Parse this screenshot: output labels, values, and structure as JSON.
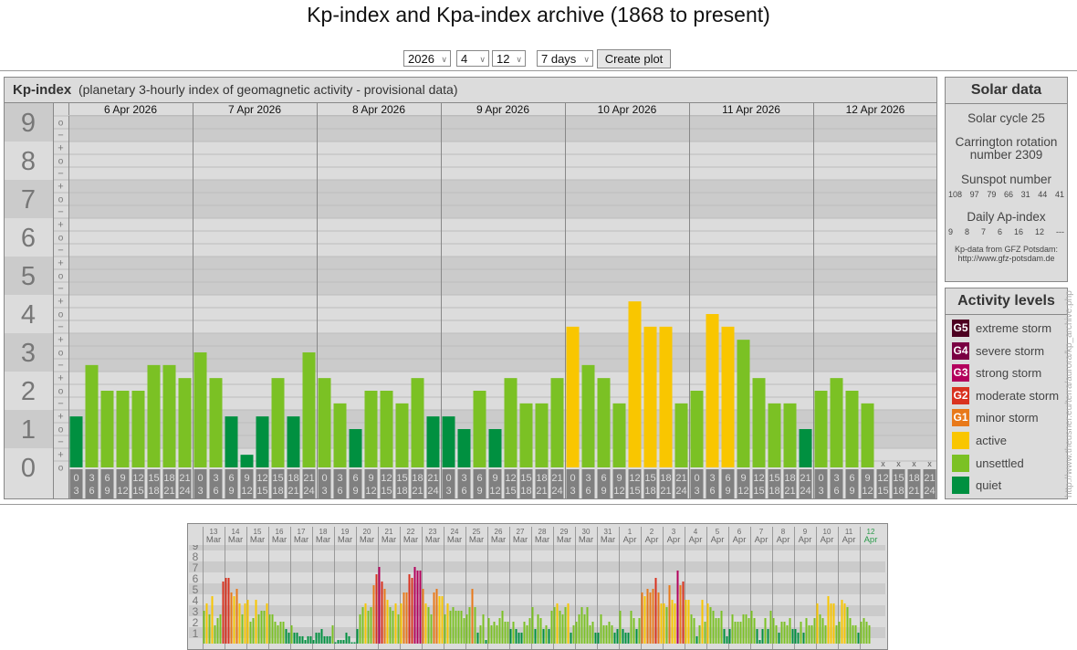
{
  "page": {
    "title": "Kp-index and Kpa-index archive (1868 to present)"
  },
  "controls": {
    "year": "2026",
    "month": "4",
    "day": "12",
    "range": "7 days",
    "create_label": "Create plot"
  },
  "kp_panel": {
    "title": "Kp-index",
    "subtitle": "(planetary 3-hourly index of geomagnetic activity - provisional data)"
  },
  "solar": {
    "title": "Solar data",
    "cycle": "Solar cycle 25",
    "carrington": "Carrington rotation number 2309",
    "sunspot_label": "Sunspot number",
    "sunspots": [
      "108",
      "97",
      "79",
      "66",
      "31",
      "44",
      "41"
    ],
    "ap_label": "Daily Ap-index",
    "ap": [
      "9",
      "8",
      "7",
      "6",
      "16",
      "12",
      "---"
    ],
    "source_line1": "Kp-data from GFZ Potsdam:",
    "source_line2": "http://www.gfz-potsdam.de"
  },
  "activity": {
    "title": "Activity levels",
    "items": [
      {
        "code": "G5",
        "label": "extreme storm",
        "color": "#4d0020"
      },
      {
        "code": "G4",
        "label": "severe storm",
        "color": "#7a0042"
      },
      {
        "code": "G3",
        "label": "strong storm",
        "color": "#b3005c"
      },
      {
        "code": "G2",
        "label": "moderate storm",
        "color": "#d9321f"
      },
      {
        "code": "G1",
        "label": "minor storm",
        "color": "#e8791a"
      },
      {
        "code": "",
        "label": "active",
        "color": "#f9c600"
      },
      {
        "code": "",
        "label": "unsettled",
        "color": "#7bc124"
      },
      {
        "code": "",
        "label": "quiet",
        "color": "#009040"
      }
    ]
  },
  "side_url": "http://www.theusner.eu/terra/aurora/kp_archive.php",
  "chart_data": [
    {
      "type": "bar",
      "title": "Kp-index",
      "ylabel": "Kp",
      "ylim": [
        0,
        9
      ],
      "y_ticks": [
        "0",
        "1",
        "2",
        "3",
        "4",
        "5",
        "6",
        "7",
        "8",
        "9"
      ],
      "y_subticks": [
        "o",
        "−",
        "+"
      ],
      "missing_marker": "x",
      "intervals": [
        [
          "0",
          "3"
        ],
        [
          "3",
          "6"
        ],
        [
          "6",
          "9"
        ],
        [
          "9",
          "12"
        ],
        [
          "12",
          "15"
        ],
        [
          "15",
          "18"
        ],
        [
          "18",
          "21"
        ],
        [
          "21",
          "24"
        ]
      ],
      "days": [
        {
          "label": "6 Apr 2026",
          "values": [
            1.33,
            2.67,
            2,
            2,
            2,
            2.67,
            2.67,
            2.33
          ]
        },
        {
          "label": "7 Apr 2026",
          "values": [
            3,
            2.33,
            1.33,
            0.33,
            1.33,
            2.33,
            1.33,
            3
          ]
        },
        {
          "label": "8 Apr 2026",
          "values": [
            2.33,
            1.67,
            1,
            2,
            2,
            1.67,
            2.33,
            1.33
          ]
        },
        {
          "label": "9 Apr 2026",
          "values": [
            1.33,
            1,
            2,
            1,
            2.33,
            1.67,
            1.67,
            2.33
          ]
        },
        {
          "label": "10 Apr 2026",
          "values": [
            3.67,
            2.67,
            2.33,
            1.67,
            4.33,
            3.67,
            3.67,
            1.67
          ]
        },
        {
          "label": "11 Apr 2026",
          "values": [
            2,
            4,
            3.67,
            3.33,
            2.33,
            1.67,
            1.67,
            1
          ]
        },
        {
          "label": "12 Apr 2026",
          "values": [
            2,
            2.33,
            2,
            1.67,
            null,
            null,
            null,
            null
          ]
        }
      ]
    },
    {
      "type": "bar",
      "title": "Kp-index last 31 days",
      "ylim": [
        0,
        9
      ],
      "y_ticks": [
        "1",
        "2",
        "3",
        "4",
        "5",
        "6",
        "7",
        "8",
        "9"
      ],
      "days": [
        {
          "d": "13",
          "m": "Mar",
          "values": [
            3,
            3.67,
            2.67,
            4.33,
            1.67,
            2.33,
            2.67,
            5.67
          ]
        },
        {
          "d": "14",
          "m": "Mar",
          "values": [
            6,
            6,
            4.67,
            4.33,
            5,
            3.67,
            2.67,
            3.67
          ]
        },
        {
          "d": "15",
          "m": "Mar",
          "values": [
            4,
            2,
            2.33,
            4,
            2.67,
            3,
            3,
            3.67
          ]
        },
        {
          "d": "16",
          "m": "Mar",
          "values": [
            2.67,
            2.67,
            2,
            1.67,
            2,
            2,
            1.33,
            1
          ]
        },
        {
          "d": "17",
          "m": "Mar",
          "values": [
            1.67,
            1,
            1,
            0.67,
            0.67,
            0.33,
            0.67,
            0.67
          ]
        },
        {
          "d": "18",
          "m": "Mar",
          "values": [
            0.33,
            1,
            1,
            1.33,
            0.67,
            0.67,
            0.67,
            1.67
          ]
        },
        {
          "d": "19",
          "m": "Mar",
          "values": [
            0,
            0.33,
            0.33,
            0.33,
            1,
            0.67,
            0,
            0
          ]
        },
        {
          "d": "20",
          "m": "Mar",
          "values": [
            1.33,
            2.67,
            3.33,
            3.67,
            3,
            3.33,
            5.33,
            6.33
          ]
        },
        {
          "d": "21",
          "m": "Mar",
          "values": [
            7,
            5.67,
            5,
            4,
            3.33,
            3,
            3.67,
            2.67
          ]
        },
        {
          "d": "22",
          "m": "Mar",
          "values": [
            3.67,
            4.67,
            4.67,
            6.33,
            6,
            7,
            6.67,
            6.67
          ]
        },
        {
          "d": "23",
          "m": "Mar",
          "values": [
            5,
            3.67,
            3.33,
            2.67,
            4.67,
            5,
            4.33,
            4.33
          ]
        },
        {
          "d": "24",
          "m": "Mar",
          "values": [
            2.67,
            3.67,
            3,
            3.33,
            3,
            3,
            3,
            2.33
          ]
        },
        {
          "d": "25",
          "m": "Mar",
          "values": [
            2.67,
            3.33,
            5,
            3.33,
            1,
            1.67,
            2.67,
            0.33
          ]
        },
        {
          "d": "26",
          "m": "Mar",
          "values": [
            2.33,
            1.67,
            2,
            1.67,
            2.33,
            3,
            2,
            2
          ]
        },
        {
          "d": "27",
          "m": "Mar",
          "values": [
            1.33,
            2,
            1.33,
            1,
            1,
            2,
            1.67,
            2.33
          ]
        },
        {
          "d": "28",
          "m": "Mar",
          "values": [
            3.33,
            1.33,
            2.67,
            2.33,
            1.33,
            1.67,
            1.33,
            3
          ]
        },
        {
          "d": "29",
          "m": "Mar",
          "values": [
            3.33,
            3.67,
            3,
            2.67,
            3.33,
            3.67,
            1,
            1.67
          ]
        },
        {
          "d": "30",
          "m": "Mar",
          "values": [
            2,
            2.67,
            3.33,
            2.67,
            3.33,
            1.67,
            2,
            1
          ]
        },
        {
          "d": "31",
          "m": "Mar",
          "values": [
            1,
            2.67,
            1.67,
            1.67,
            2,
            1.67,
            1,
            1.33
          ]
        },
        {
          "d": "1",
          "m": "Apr",
          "values": [
            3,
            1.33,
            1,
            1,
            3,
            2.33,
            1.33,
            2.33
          ]
        },
        {
          "d": "2",
          "m": "Apr",
          "values": [
            4.67,
            4.33,
            5,
            4.67,
            5,
            6,
            4.67,
            3.67
          ]
        },
        {
          "d": "3",
          "m": "Apr",
          "values": [
            3.67,
            3.33,
            5.33,
            4,
            3.67,
            6.67,
            5.33,
            5.67
          ]
        },
        {
          "d": "4",
          "m": "Apr",
          "values": [
            4,
            4,
            2.67,
            2.33,
            0.67,
            1.67,
            4,
            2
          ]
        },
        {
          "d": "5",
          "m": "Apr",
          "values": [
            3.67,
            3.33,
            3,
            2.33,
            2.33,
            3,
            1.33,
            0.67
          ]
        },
        {
          "d": "6",
          "m": "Apr",
          "values": [
            1.33,
            2.67,
            2,
            2,
            2,
            2.67,
            2.67,
            2.33
          ]
        },
        {
          "d": "7",
          "m": "Apr",
          "values": [
            3,
            2.33,
            1.33,
            0.33,
            1.33,
            2.33,
            1.33,
            3
          ]
        },
        {
          "d": "8",
          "m": "Apr",
          "values": [
            2.33,
            1.67,
            1,
            2,
            2,
            1.67,
            2.33,
            1.33
          ]
        },
        {
          "d": "9",
          "m": "Apr",
          "values": [
            1.33,
            1,
            2,
            1,
            2.33,
            1.67,
            1.67,
            2.33
          ]
        },
        {
          "d": "10",
          "m": "Apr",
          "values": [
            3.67,
            2.67,
            2.33,
            1.67,
            4.33,
            3.67,
            3.67,
            1.67
          ]
        },
        {
          "d": "11",
          "m": "Apr",
          "values": [
            2,
            4,
            3.67,
            3.33,
            2.33,
            1.67,
            1.67,
            1
          ]
        },
        {
          "d": "12",
          "m": "Apr",
          "values": [
            2,
            2.33,
            2,
            1.67
          ]
        }
      ],
      "current_day_color": "#2a9a4a"
    }
  ]
}
